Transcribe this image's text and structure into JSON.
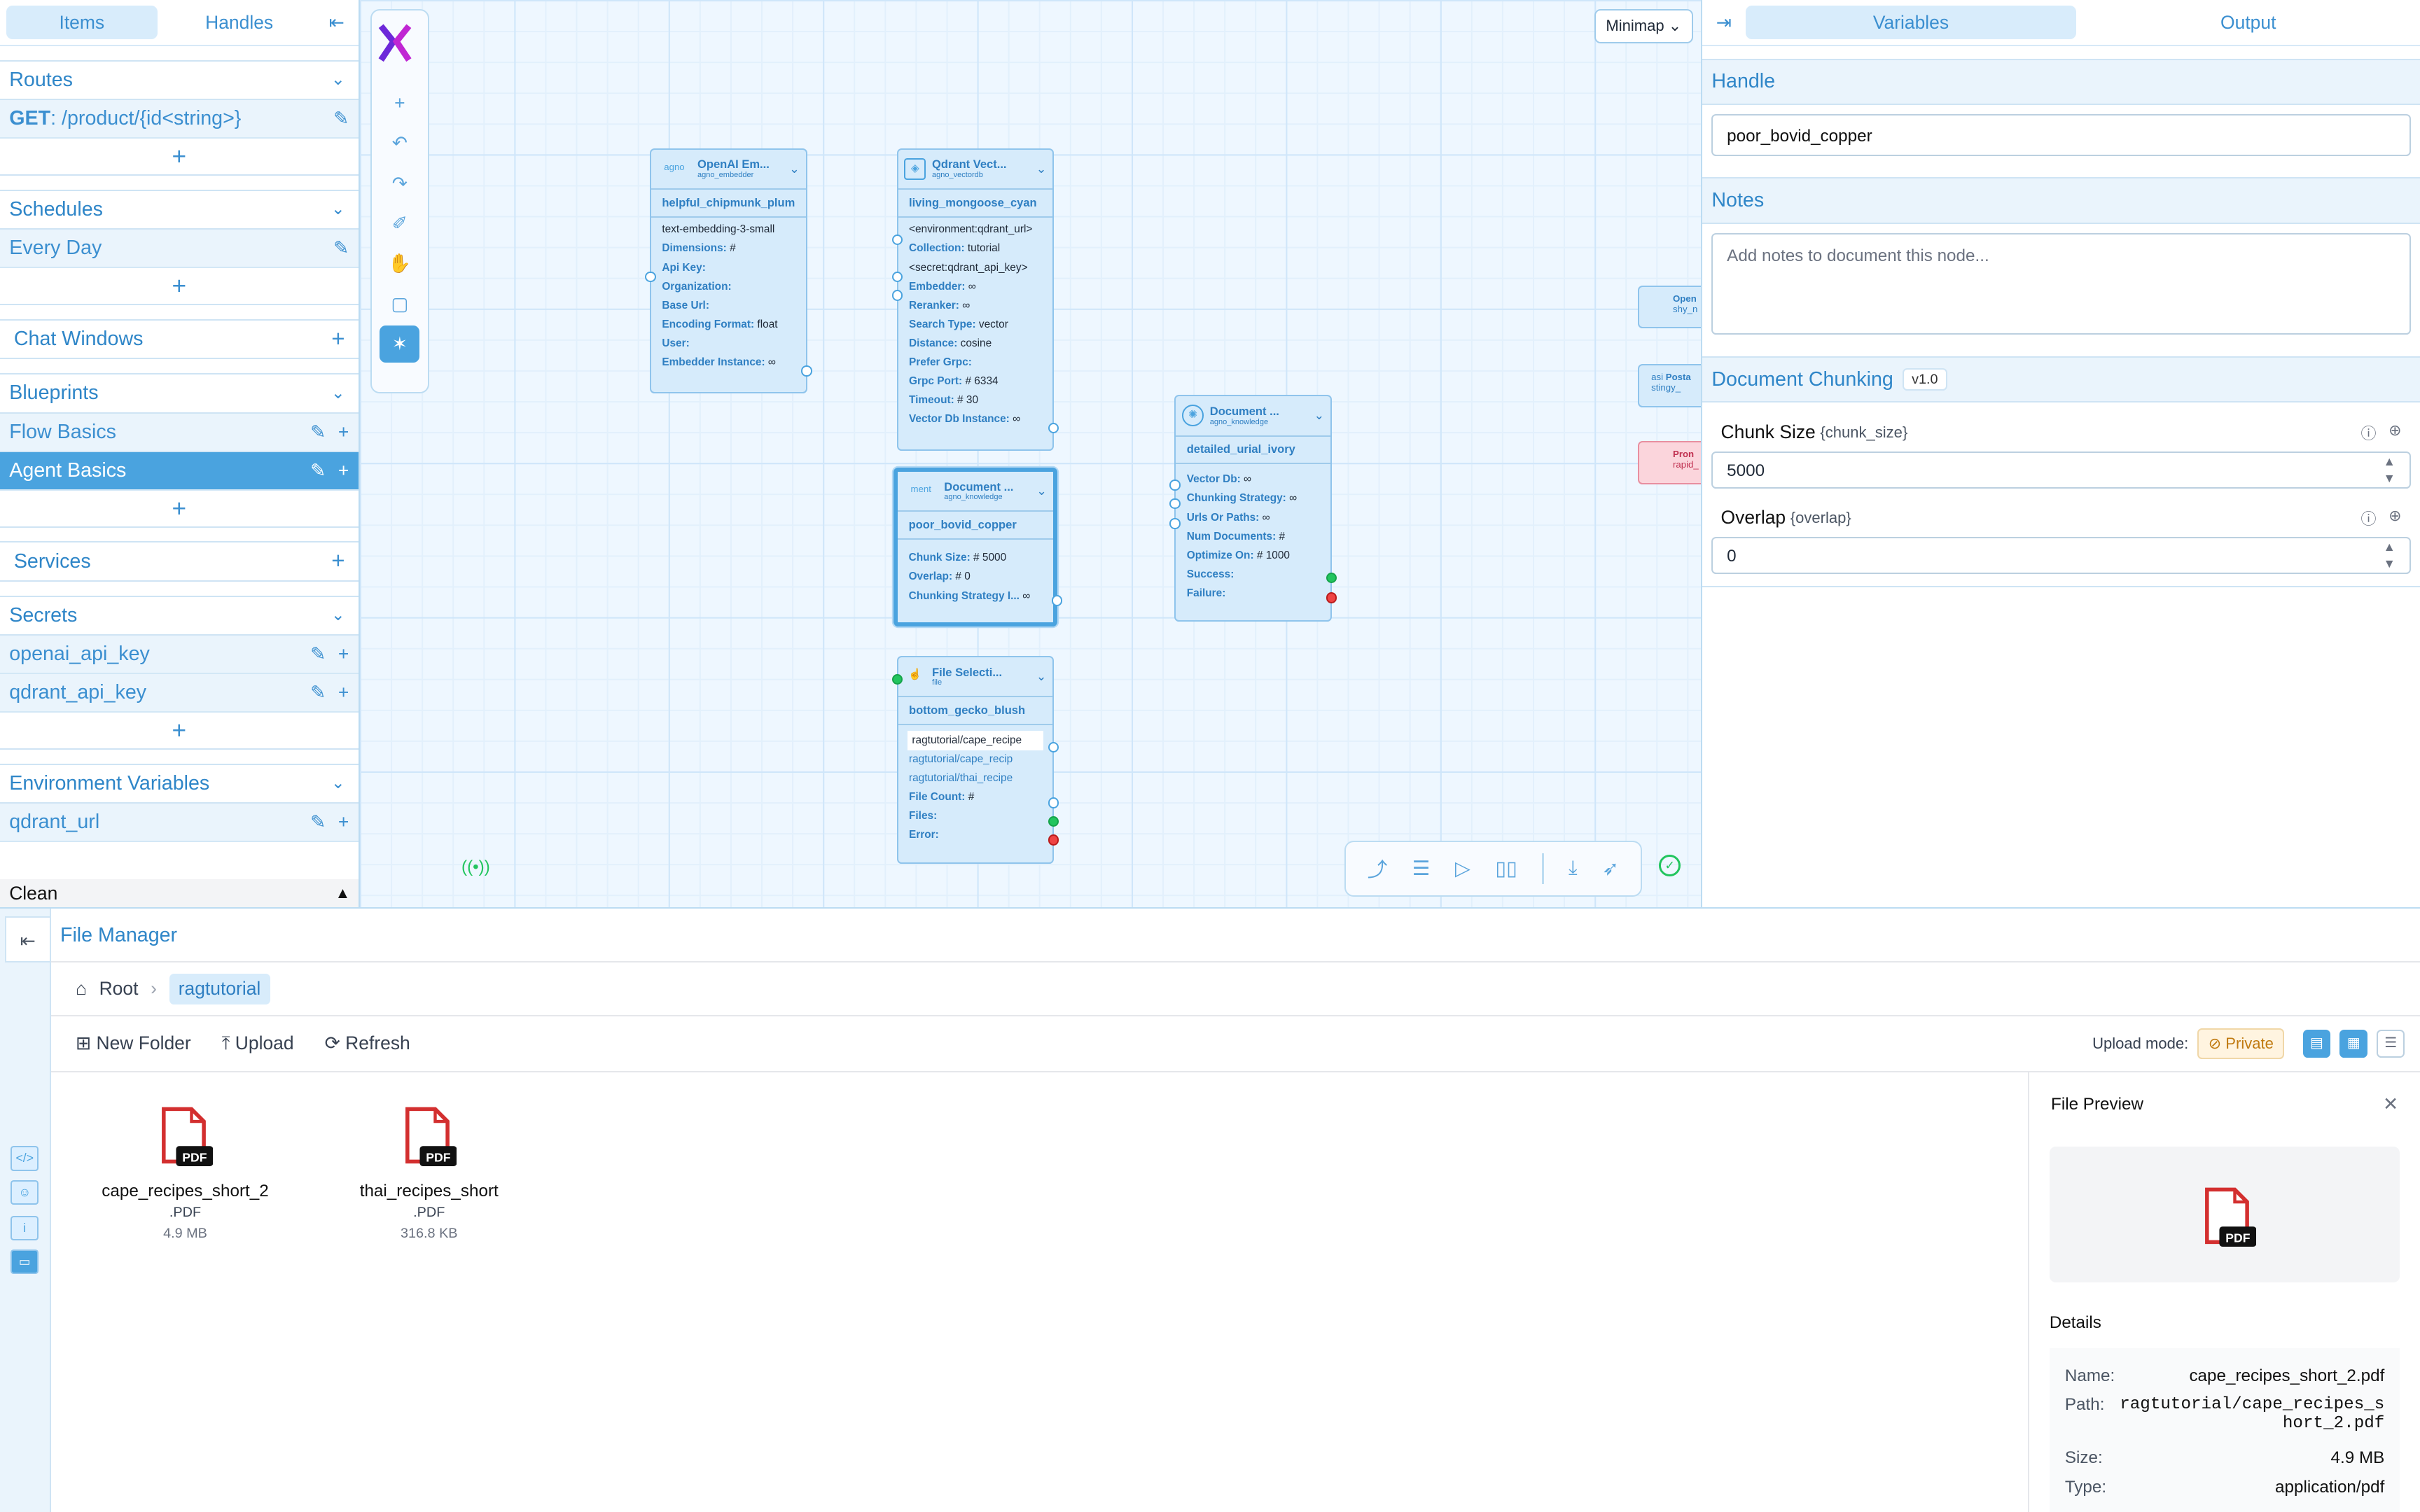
{
  "sidebar": {
    "tabs": [
      "Items",
      "Handles"
    ],
    "routes": {
      "title": "Routes",
      "items": [
        {
          "method": "GET",
          "path": ": /product/{id<string>}"
        }
      ]
    },
    "schedules": {
      "title": "Schedules",
      "items": [
        "Every Day"
      ]
    },
    "chat_windows": {
      "title": "Chat Windows"
    },
    "blueprints": {
      "title": "Blueprints",
      "items": [
        "Flow Basics",
        "Agent Basics"
      ]
    },
    "services": {
      "title": "Services"
    },
    "secrets": {
      "title": "Secrets",
      "items": [
        "openai_api_key",
        "qdrant_api_key"
      ]
    },
    "env_vars": {
      "title": "Environment Variables",
      "items": [
        "qdrant_url"
      ]
    },
    "footer": "Clean"
  },
  "canvas": {
    "minimap": "Minimap",
    "nodes": {
      "embedder": {
        "title": "OpenAI Em...",
        "subtitle": "agno_embedder",
        "icon": "agno",
        "name": "helpful_chipmunk_plum",
        "rows": [
          [
            "",
            "text-embedding-3-small"
          ],
          [
            "Dimensions:",
            "#"
          ],
          [
            "Api Key:",
            ""
          ],
          [
            "Organization:",
            ""
          ],
          [
            "Base Url:",
            ""
          ],
          [
            "Encoding Format:",
            "float"
          ],
          [
            "User:",
            ""
          ],
          [
            "Embedder Instance:",
            "∞"
          ]
        ]
      },
      "qdrant": {
        "title": "Qdrant Vect...",
        "subtitle": "agno_vectordb",
        "name": "living_mongoose_cyan",
        "rows": [
          [
            "",
            "<environment:qdrant_url>"
          ],
          [
            "Collection:",
            "tutorial"
          ],
          [
            "",
            "<secret:qdrant_api_key>"
          ],
          [
            "Embedder:",
            "∞"
          ],
          [
            "Reranker:",
            "∞"
          ],
          [
            "Search Type:",
            "vector"
          ],
          [
            "Distance:",
            "cosine"
          ],
          [
            "Prefer Grpc:",
            ""
          ],
          [
            "Grpc Port:",
            "# 6334"
          ],
          [
            "Timeout:",
            "# 30"
          ],
          [
            "Vector Db Instance:",
            "∞"
          ]
        ]
      },
      "chunker": {
        "title": "Document ...",
        "subtitle": "agno_knowledge",
        "icon": "ment",
        "name": "poor_bovid_copper",
        "rows": [
          [
            "Chunk Size:",
            "# 5000"
          ],
          [
            "Overlap:",
            "# 0"
          ],
          [
            "Chunking Strategy I...",
            "∞"
          ]
        ]
      },
      "knowledge": {
        "title": "Document ...",
        "subtitle": "agno_knowledge",
        "name": "detailed_urial_ivory",
        "rows": [
          [
            "Vector Db:",
            "∞"
          ],
          [
            "Chunking Strategy:",
            "∞"
          ],
          [
            "Urls Or Paths:",
            "∞"
          ],
          [
            "Num Documents:",
            "#"
          ],
          [
            "Optimize On:",
            "# 1000"
          ],
          [
            "Success:",
            ""
          ],
          [
            "Failure:",
            ""
          ]
        ]
      },
      "file_selection": {
        "title": "File Selecti...",
        "subtitle": "file",
        "name": "bottom_gecko_blush",
        "rows": [
          [
            "",
            "ragtutorial/cape_recipe"
          ],
          [
            "",
            "ragtutorial/cape_recip"
          ],
          [
            "",
            "ragtutorial/thai_recipe"
          ],
          [
            "File Count:",
            "#"
          ],
          [
            "Files:",
            ""
          ],
          [
            "Error:",
            ""
          ]
        ]
      },
      "edge": [
        {
          "title": "Open",
          "subtitle": "shy_n"
        },
        {
          "title": "Posta",
          "subtitle": "stingy_",
          "icon": "asi"
        },
        {
          "title": "Pron",
          "subtitle": "rapid_"
        }
      ]
    }
  },
  "right_panel": {
    "tabs": [
      "Variables",
      "Output"
    ],
    "handle": {
      "title": "Handle",
      "value": "poor_bovid_copper"
    },
    "notes": {
      "title": "Notes",
      "placeholder": "Add notes to document this node..."
    },
    "chunking": {
      "title": "Document Chunking",
      "version": "v1.0",
      "fields": [
        {
          "label": "Chunk Size",
          "key": "{chunk_size}",
          "value": "5000"
        },
        {
          "label": "Overlap",
          "key": "{overlap}",
          "value": "0"
        }
      ]
    }
  },
  "file_manager": {
    "title": "File Manager",
    "breadcrumb": [
      "Root",
      "ragtutorial"
    ],
    "actions": [
      "New Folder",
      "Upload",
      "Refresh"
    ],
    "upload_mode_label": "Upload mode:",
    "upload_mode": "Private",
    "files": [
      {
        "name": "cape_recipes_short_2",
        "ext": ".PDF",
        "size": "4.9 MB"
      },
      {
        "name": "thai_recipes_short",
        "ext": ".PDF",
        "size": "316.8 KB"
      }
    ],
    "preview": {
      "title": "File Preview",
      "details_title": "Details",
      "badge": "PDF",
      "details": [
        {
          "k": "Name:",
          "v": "cape_recipes_short_2.pdf"
        },
        {
          "k": "Path:",
          "v": "ragtutorial/cape_recipes_short_2.pdf"
        },
        {
          "k": "Size:",
          "v": "4.9 MB"
        },
        {
          "k": "Type:",
          "v": "application/pdf"
        }
      ]
    }
  }
}
